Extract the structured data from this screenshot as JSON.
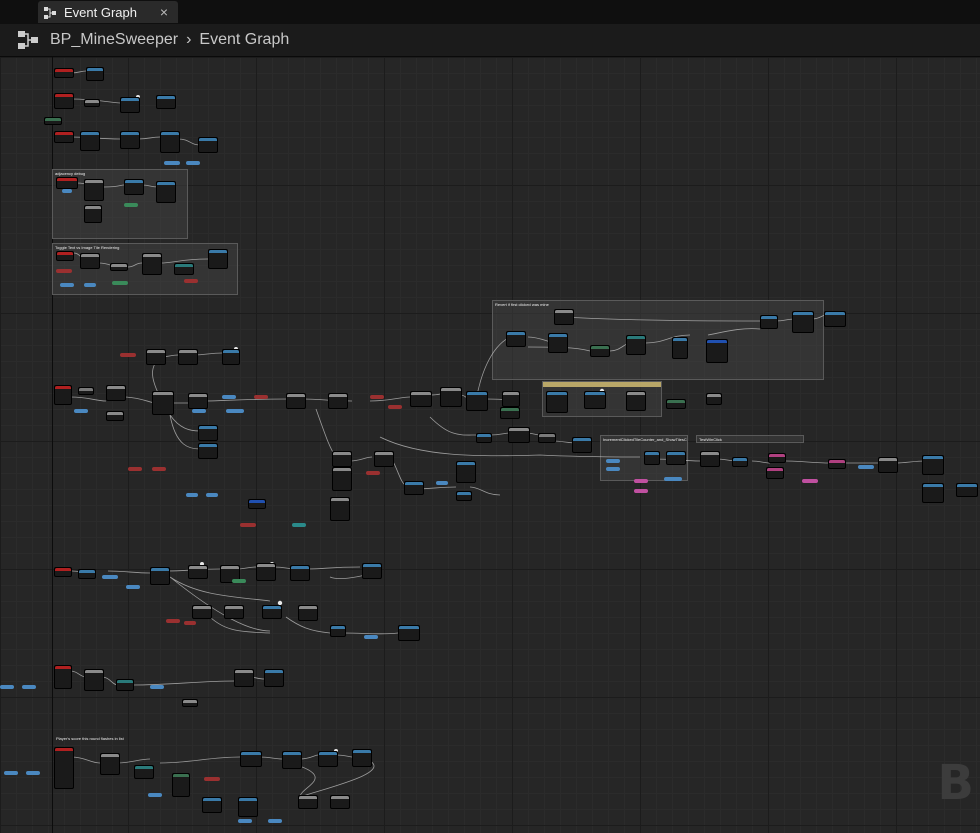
{
  "tab": {
    "label": "Event Graph",
    "close_glyph": "×"
  },
  "breadcrumb": {
    "blueprint": "BP_MineSweeper",
    "separator": "›",
    "graph": "Event Graph"
  },
  "comments": {
    "adjacency": "adjacency debug",
    "toggle": "Toggle Text vs Image Tile Rendering",
    "revert": "Revert if first clicked was mine",
    "increment": "IncrementClickedTileCounter_and_ShowTilesClicked",
    "win": "TestWinClick",
    "flashes": "Player's score this round flashes in list of scores"
  },
  "watermark": "B"
}
